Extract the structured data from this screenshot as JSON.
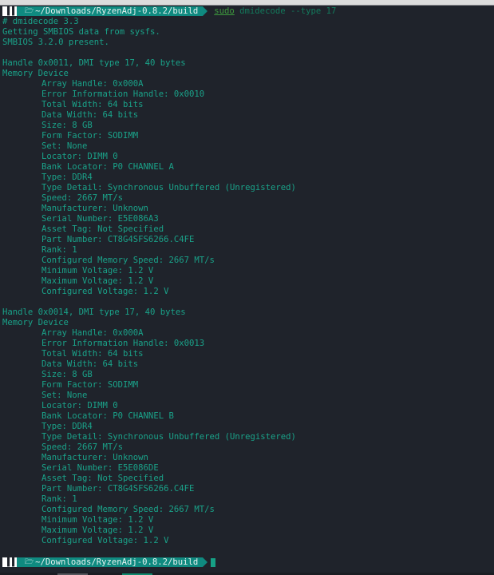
{
  "prompt": {
    "os_icon": "manjaro-logo-icon",
    "folder_icon": "folder-open-icon",
    "path": "~/Downloads/RyzenAdj-0.8.2/build",
    "command_sudo": "sudo",
    "command_rest": " dmidecode --type 17"
  },
  "header_lines": [
    "# dmidecode 3.3",
    "Getting SMBIOS data from sysfs.",
    "SMBIOS 3.2.0 present."
  ],
  "devices": [
    {
      "handle": "Handle 0x0011, DMI type 17, 40 bytes",
      "title": "Memory Device",
      "fields": [
        "Array Handle: 0x000A",
        "Error Information Handle: 0x0010",
        "Total Width: 64 bits",
        "Data Width: 64 bits",
        "Size: 8 GB",
        "Form Factor: SODIMM",
        "Set: None",
        "Locator: DIMM 0",
        "Bank Locator: P0 CHANNEL A",
        "Type: DDR4",
        "Type Detail: Synchronous Unbuffered (Unregistered)",
        "Speed: 2667 MT/s",
        "Manufacturer: Unknown",
        "Serial Number: E5E086A3",
        "Asset Tag: Not Specified",
        "Part Number: CT8G4SFS6266.C4FE",
        "Rank: 1",
        "Configured Memory Speed: 2667 MT/s",
        "Minimum Voltage: 1.2 V",
        "Maximum Voltage: 1.2 V",
        "Configured Voltage: 1.2 V"
      ]
    },
    {
      "handle": "Handle 0x0014, DMI type 17, 40 bytes",
      "title": "Memory Device",
      "fields": [
        "Array Handle: 0x000A",
        "Error Information Handle: 0x0013",
        "Total Width: 64 bits",
        "Data Width: 64 bits",
        "Size: 8 GB",
        "Form Factor: SODIMM",
        "Set: None",
        "Locator: DIMM 0",
        "Bank Locator: P0 CHANNEL B",
        "Type: DDR4",
        "Type Detail: Synchronous Unbuffered (Unregistered)",
        "Speed: 2667 MT/s",
        "Manufacturer: Unknown",
        "Serial Number: E5E086DE",
        "Asset Tag: Not Specified",
        "Part Number: CT8G4SFS6266.C4FE",
        "Rank: 1",
        "Configured Memory Speed: 2667 MT/s",
        "Minimum Voltage: 1.2 V",
        "Maximum Voltage: 1.2 V",
        "Configured Voltage: 1.2 V"
      ]
    }
  ],
  "colors": {
    "background": "#1f232b",
    "text": "#1aa289",
    "prompt_path_bg": "#0f8a80",
    "cursor": "#16a085"
  }
}
